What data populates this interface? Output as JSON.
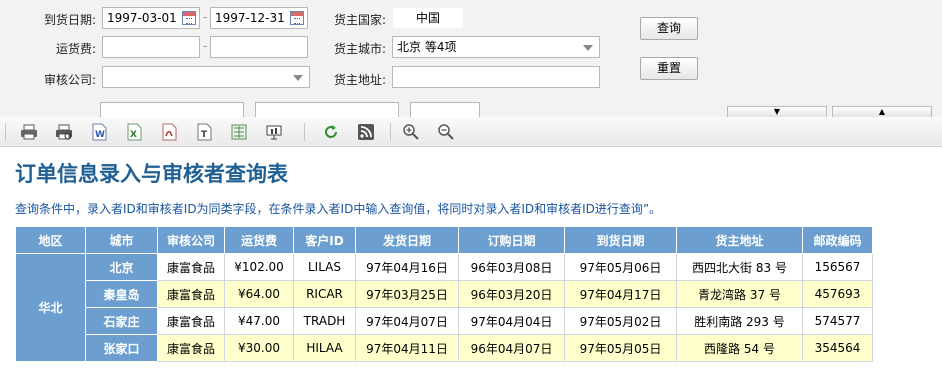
{
  "form": {
    "arrival_date_label": "到货日期:",
    "arrival_date_from": "1997-03-01",
    "arrival_date_to": "1997-12-31",
    "freight_label": "运货费:",
    "freight_from": "",
    "freight_to": "",
    "reviewer_company_label": "审核公司:",
    "reviewer_company_value": "",
    "owner_country_label": "货主国家:",
    "owner_country_value": "中国",
    "owner_city_label": "货主城市:",
    "owner_city_value": "北京  等4项",
    "owner_address_label": "货主地址:",
    "owner_address_value": "",
    "query_button": "查询",
    "reset_button": "重置",
    "collapse_down": "▼",
    "collapse_up": "▲"
  },
  "toolbar": {
    "icons": [
      "print-icon",
      "print-preview-icon",
      "export-word-icon",
      "export-excel-icon",
      "export-pdf-icon",
      "export-text-icon",
      "export-image-icon",
      "slideshow-icon",
      "refresh-icon",
      "rss-icon",
      "zoom-in-icon",
      "zoom-out-icon"
    ]
  },
  "report": {
    "title": "订单信息录入与审核者查询表",
    "note": "查询条件中，录入者ID和审核者ID为同类字段，在条件录入者ID中输入查询值，将同时对录入者ID和审核者ID进行查询”。",
    "columns": [
      "地区",
      "城市",
      "审核公司",
      "运货费",
      "客户ID",
      "发货日期",
      "订购日期",
      "到货日期",
      "货主地址",
      "邮政编码"
    ],
    "region": "华北",
    "rows": [
      {
        "city": "北京",
        "company": "康富食品",
        "freight": "¥102.00",
        "customer": "LILAS",
        "ship_date": "97年04月16日",
        "order_date": "96年03月08日",
        "arrival_date": "97年05月06日",
        "address": "西四北大街 83 号",
        "postcode": "156567"
      },
      {
        "city": "秦皇岛",
        "company": "康富食品",
        "freight": "¥64.00",
        "customer": "RICAR",
        "ship_date": "97年03月25日",
        "order_date": "96年03月20日",
        "arrival_date": "97年04月17日",
        "address": "青龙湾路 37 号",
        "postcode": "457693"
      },
      {
        "city": "石家庄",
        "company": "康富食品",
        "freight": "¥47.00",
        "customer": "TRADH",
        "ship_date": "97年04月07日",
        "order_date": "97年04月04日",
        "arrival_date": "97年05月02日",
        "address": "胜利南路 293 号",
        "postcode": "574577"
      },
      {
        "city": "张家口",
        "company": "康富食品",
        "freight": "¥30.00",
        "customer": "HILAA",
        "ship_date": "97年04月11日",
        "order_date": "96年04月07日",
        "arrival_date": "97年05月05日",
        "address": "西隆路 54 号",
        "postcode": "354564"
      }
    ]
  },
  "colors": {
    "header_blue": "#6c9fd0",
    "title_blue": "#1f5f93",
    "note_blue": "#1a55a0",
    "alt_row": "#ffffcc"
  }
}
